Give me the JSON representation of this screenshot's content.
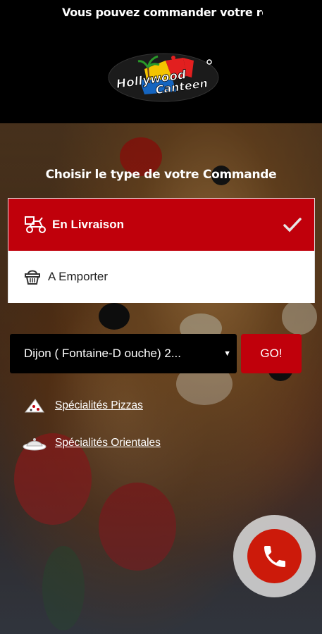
{
  "header": {
    "ticker_text": "Vous pouvez commander votre rep",
    "logo": {
      "line1": "Hollywood",
      "line2": "Canteen"
    }
  },
  "order": {
    "question": "Choisir le type de votre Commande",
    "options": [
      {
        "label": "En Livraison",
        "icon": "delivery-scooter-icon",
        "selected": true
      },
      {
        "label": "A Emporter",
        "icon": "basket-icon",
        "selected": false
      }
    ]
  },
  "location": {
    "selected_value": "Dijon ( Fontaine-D ouche) 2...",
    "go_label": "GO!"
  },
  "links": [
    {
      "label": "Spécialités Pizzas",
      "icon": "pizza-slice-icon"
    },
    {
      "label": "Spécialités Orientales",
      "icon": "tajine-icon"
    }
  ],
  "colors": {
    "accent_red": "#c0000b",
    "call_red": "#cc1a0a",
    "background": "#000000"
  },
  "call_button": {
    "icon": "phone-icon"
  }
}
